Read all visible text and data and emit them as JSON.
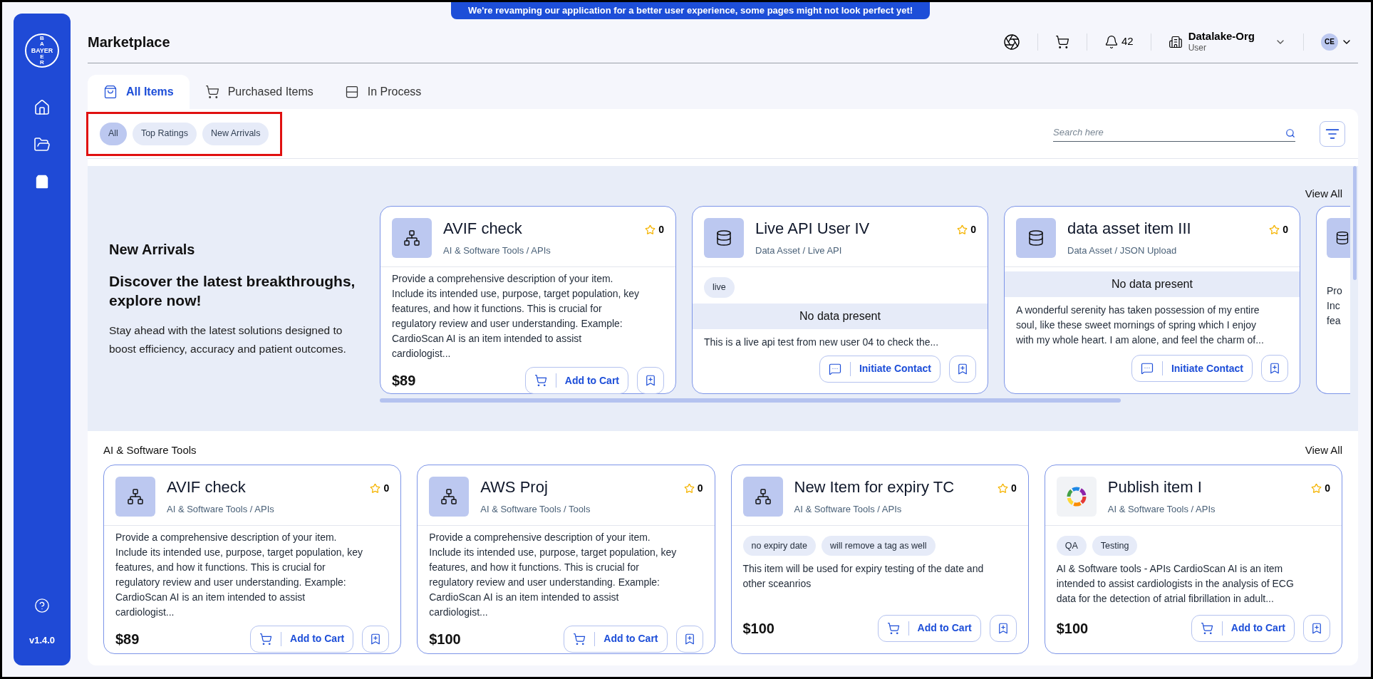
{
  "banner": "We're revamping our application for a better user experience, some pages might not look perfect yet!",
  "sidebar": {
    "logo": {
      "vertical_top": "BA",
      "horizontal": "BAYER",
      "vertical_bottom": "ER"
    },
    "nav": [
      {
        "kind": "home",
        "selected": false
      },
      {
        "kind": "folder",
        "selected": false
      },
      {
        "kind": "bag",
        "selected": true
      }
    ],
    "version": "v1.4.0"
  },
  "header": {
    "title": "Marketplace",
    "notifications": "42",
    "org": {
      "name": "Datalake-Org",
      "role": "User"
    },
    "avatar": "CE"
  },
  "tabs": [
    {
      "label": "All Items",
      "kind": "bag",
      "selected": true
    },
    {
      "label": "Purchased Items",
      "kind": "cart",
      "selected": false
    },
    {
      "label": "In Process",
      "kind": "stack",
      "selected": false
    }
  ],
  "filters": {
    "highlighted": true,
    "chips": [
      {
        "label": "All",
        "selected": true
      },
      {
        "label": "Top Ratings",
        "selected": false
      },
      {
        "label": "New Arrivals",
        "selected": false
      }
    ]
  },
  "search": {
    "placeholder": "Search here"
  },
  "new_arrivals": {
    "title": "New Arrivals",
    "headline": "Discover the latest breakthroughs, explore now!",
    "text": "Stay ahead with the latest solutions designed to boost efficiency, accuracy and patient outcomes.",
    "view_all": "View All",
    "cards": [
      {
        "kind": "network",
        "title": "AVIF check",
        "category": "AI & Software Tools / APIs",
        "rating": "0",
        "description": "Provide a comprehensive description of your item. Include its intended use, purpose, target population, key features, and how it functions. This is crucial for regulatory review and user understanding. Example: CardioScan AI is an item intended to assist cardiologist...",
        "price": "$89",
        "action": {
          "kind": "cart",
          "label": "Add to Cart"
        }
      },
      {
        "kind": "database",
        "title": "Live API User IV",
        "category": "Data Asset / Live API",
        "rating": "0",
        "tags": [
          "live"
        ],
        "no_data": "No data present",
        "description": "This is a live api test from new user 04 to check the...",
        "action": {
          "kind": "contact",
          "label": "Initiate Contact"
        }
      },
      {
        "kind": "database",
        "title": "data asset item III",
        "category": "Data Asset / JSON Upload",
        "rating": "0",
        "no_data": "No data present",
        "description": "A wonderful serenity has taken possession of my entire soul, like these sweet mornings of spring which I enjoy with my whole heart. I am alone, and feel the charm of...",
        "action": {
          "kind": "contact",
          "label": "Initiate Contact"
        }
      }
    ],
    "partial_card": {
      "kind": "database",
      "lines": [
        "Pro",
        "Inc",
        "fea"
      ]
    }
  },
  "sections": [
    {
      "title": "AI & Software Tools",
      "view_all": "View All",
      "cards": [
        {
          "kind": "network",
          "title": "AVIF check",
          "category": "AI & Software Tools / APIs",
          "rating": "0",
          "description": "Provide a comprehensive description of your item. Include its intended use, purpose, target population, key features, and how it functions. This is crucial for regulatory review and user understanding. Example: CardioScan AI is an item intended to assist cardiologist...",
          "price": "$89",
          "action": {
            "kind": "cart",
            "label": "Add to Cart"
          }
        },
        {
          "kind": "network",
          "title": "AWS Proj",
          "category": "AI & Software Tools / Tools",
          "rating": "0",
          "description": "Provide a comprehensive description of your item. Include its intended use, purpose, target population, key features, and how it functions. This is crucial for regulatory review and user understanding. Example: CardioScan AI is an item intended to assist cardiologist...",
          "price": "$100",
          "action": {
            "kind": "cart",
            "label": "Add to Cart"
          }
        },
        {
          "kind": "network",
          "title": "New Item for expiry TC",
          "category": "AI & Software Tools / APIs",
          "rating": "0",
          "tags": [
            "no expiry date",
            "will remove a tag as well"
          ],
          "description": "This item will be used for expiry testing of the date and other sceanrios",
          "price": "$100",
          "action": {
            "kind": "cart",
            "label": "Add to Cart"
          }
        },
        {
          "kind": "ring",
          "title": "Publish item I",
          "category": "AI & Software Tools / APIs",
          "rating": "0",
          "tags": [
            "QA",
            "Testing"
          ],
          "description": "AI & Software tools - APIs CardioScan AI is an item intended to assist cardiologists in the analysis of ECG data for the detection of atrial fibrillation in adult...",
          "price": "$100",
          "action": {
            "kind": "cart",
            "label": "Add to Cart"
          }
        }
      ]
    }
  ]
}
